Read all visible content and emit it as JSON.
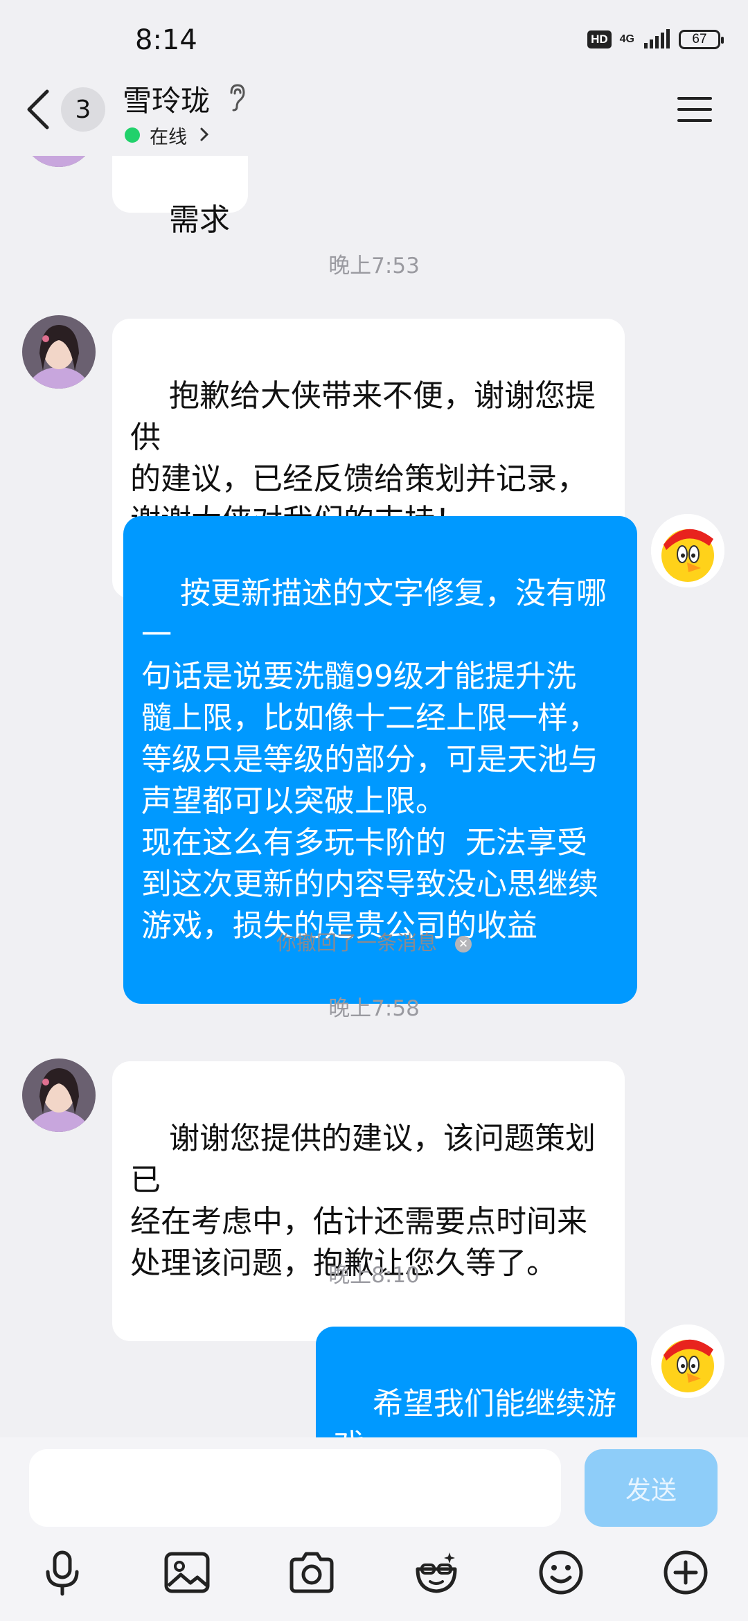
{
  "status_bar": {
    "time": "8:14",
    "hd": "HD",
    "network": "4G",
    "battery": "67"
  },
  "header": {
    "badge_count": "3",
    "title": "雪玲珑",
    "status": "在线"
  },
  "messages": {
    "partial_top": "需求",
    "time1": "晚上7:53",
    "npc1": "抱歉给大侠带来不便，谢谢您提供\n的建议，已经反馈给策划并记录，\n谢谢大侠对我们的支持！",
    "me1": "按更新描述的文字修复，没有哪一\n句话是说要洗髓99级才能提升洗\n髓上限，比如像十二经上限一样，\n等级只是等级的部分，可是天池与\n声望都可以突破上限。\n现在这么有多玩卡阶的  无法享受\n到这次更新的内容导致没心思继续\n游戏，损失的是贵公司的收益",
    "recall": "你撤回了一条消息",
    "time2": "晚上7:58",
    "npc2": "谢谢您提供的建议，该问题策划已\n经在考虑中，估计还需要点时间来\n处理该问题，抱歉让您久等了。",
    "time3": "晚上8:10",
    "me2": "希望我们能继续游戏"
  },
  "input": {
    "send_label": "发送"
  },
  "toolbar": [
    "microphone-icon",
    "image-icon",
    "camera-icon",
    "emoji-face-icon",
    "smiley-icon",
    "plus-icon"
  ],
  "colors": {
    "outgoing_bubble": "#0099ff",
    "send_disabled": "#8ecdf9",
    "online": "#21d16b"
  }
}
